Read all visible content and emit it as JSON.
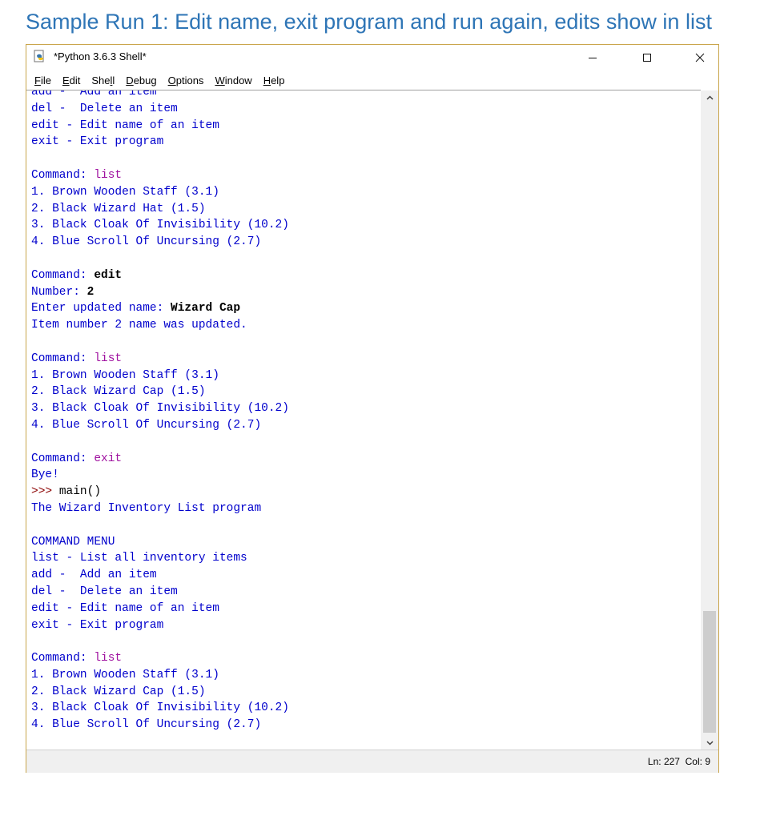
{
  "caption": "Sample Run 1: Edit name, exit program and run again, edits show in list",
  "window": {
    "title": "*Python 3.6.3 Shell*",
    "icon": "python-idle-icon",
    "controls": [
      "minimize",
      "maximize",
      "close"
    ]
  },
  "menu": [
    {
      "pre": "",
      "u": "F",
      "post": "ile"
    },
    {
      "pre": "",
      "u": "E",
      "post": "dit"
    },
    {
      "pre": "She",
      "u": "l",
      "post": "l"
    },
    {
      "pre": "",
      "u": "D",
      "post": "ebug"
    },
    {
      "pre": "",
      "u": "O",
      "post": "ptions"
    },
    {
      "pre": "",
      "u": "W",
      "post": "indow"
    },
    {
      "pre": "",
      "u": "H",
      "post": "elp"
    }
  ],
  "shell_lines": [
    [
      {
        "t": "add -  Add an item",
        "c": "out"
      }
    ],
    [
      {
        "t": "del -  Delete an item",
        "c": "out"
      }
    ],
    [
      {
        "t": "edit - Edit name of an item",
        "c": "out"
      }
    ],
    [
      {
        "t": "exit - Exit program",
        "c": "out"
      }
    ],
    [],
    [
      {
        "t": "Command: ",
        "c": "out"
      },
      {
        "t": "list",
        "c": "cmd"
      }
    ],
    [
      {
        "t": "1. Brown Wooden Staff (3.1)",
        "c": "out"
      }
    ],
    [
      {
        "t": "2. Black Wizard Hat (1.5)",
        "c": "out"
      }
    ],
    [
      {
        "t": "3. Black Cloak Of Invisibility (10.2)",
        "c": "out"
      }
    ],
    [
      {
        "t": "4. Blue Scroll Of Uncursing (2.7)",
        "c": "out"
      }
    ],
    [],
    [
      {
        "t": "Command: ",
        "c": "out"
      },
      {
        "t": "edit",
        "c": "in"
      }
    ],
    [
      {
        "t": "Number: ",
        "c": "out"
      },
      {
        "t": "2",
        "c": "in"
      }
    ],
    [
      {
        "t": "Enter updated name: ",
        "c": "out"
      },
      {
        "t": "Wizard Cap",
        "c": "in"
      }
    ],
    [
      {
        "t": "Item number 2 name was updated.",
        "c": "out"
      }
    ],
    [],
    [
      {
        "t": "Command: ",
        "c": "out"
      },
      {
        "t": "list",
        "c": "cmd"
      }
    ],
    [
      {
        "t": "1. Brown Wooden Staff (3.1)",
        "c": "out"
      }
    ],
    [
      {
        "t": "2. Black Wizard Cap (1.5)",
        "c": "out"
      }
    ],
    [
      {
        "t": "3. Black Cloak Of Invisibility (10.2)",
        "c": "out"
      }
    ],
    [
      {
        "t": "4. Blue Scroll Of Uncursing (2.7)",
        "c": "out"
      }
    ],
    [],
    [
      {
        "t": "Command: ",
        "c": "out"
      },
      {
        "t": "exit",
        "c": "cmd"
      }
    ],
    [
      {
        "t": "Bye!",
        "c": "out"
      }
    ],
    [
      {
        "t": ">>> ",
        "c": "prompt"
      },
      {
        "t": "main()",
        "c": "pin"
      }
    ],
    [
      {
        "t": "The Wizard Inventory List program",
        "c": "out"
      }
    ],
    [],
    [
      {
        "t": "COMMAND MENU",
        "c": "out"
      }
    ],
    [
      {
        "t": "list - List all inventory items",
        "c": "out"
      }
    ],
    [
      {
        "t": "add -  Add an item",
        "c": "out"
      }
    ],
    [
      {
        "t": "del -  Delete an item",
        "c": "out"
      }
    ],
    [
      {
        "t": "edit - Edit name of an item",
        "c": "out"
      }
    ],
    [
      {
        "t": "exit - Exit program",
        "c": "out"
      }
    ],
    [],
    [
      {
        "t": "Command: ",
        "c": "out"
      },
      {
        "t": "list",
        "c": "cmd"
      }
    ],
    [
      {
        "t": "1. Brown Wooden Staff (3.1)",
        "c": "out"
      }
    ],
    [
      {
        "t": "2. Black Wizard Cap (1.5)",
        "c": "out"
      }
    ],
    [
      {
        "t": "3. Black Cloak Of Invisibility (10.2)",
        "c": "out"
      }
    ],
    [
      {
        "t": "4. Blue Scroll Of Uncursing (2.7)",
        "c": "out"
      }
    ],
    []
  ],
  "status": {
    "line": "Ln: 227",
    "col": "Col: 9"
  },
  "colors": {
    "output": "#0000cc",
    "user_input": "#000000",
    "command_keyword": "#a012a0",
    "prompt": "#8b0000",
    "caption": "#2e75b6",
    "window_border": "#c9a54b"
  }
}
